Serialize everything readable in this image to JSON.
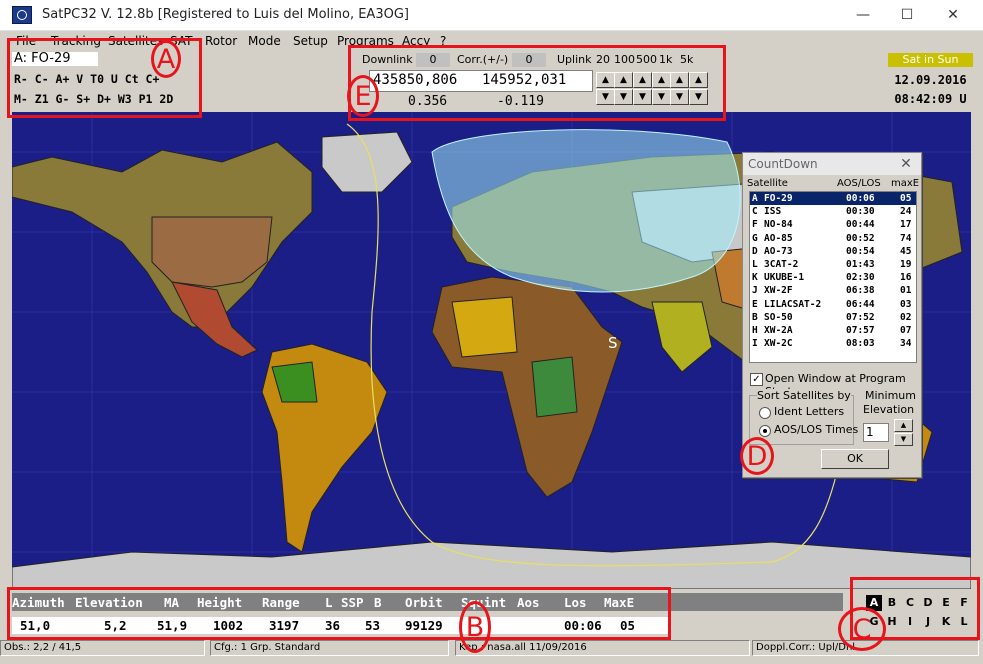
{
  "window": {
    "title": "SatPC32 V. 12.8b   [Registered to Luis del Molino, EA3OG]",
    "minimize": "—",
    "maximize": "☐",
    "close": "✕"
  },
  "menu": [
    "File",
    "Tracking",
    "Satellites",
    "SAT",
    "Rotor",
    "Mode",
    "Setup",
    "Programs",
    "Accy",
    "?"
  ],
  "satellite": {
    "current": "A: FO-29",
    "flags_row1": "R- C- A+ V T0 U Ct C+",
    "flags_row2": "M- Z1 G- S+ D+ W3 P1 2D"
  },
  "frequency": {
    "downlink_label": "Downlink",
    "downlink_value": "0",
    "corr_label": "Corr.(+/-)",
    "corr_value": "0",
    "uplink_label": "Uplink",
    "steps": [
      "20",
      "100",
      "500",
      "1k",
      "5k"
    ],
    "freq_down": "435850,806",
    "freq_up": "145952,031",
    "doppler_down": "0.356",
    "doppler_up": "-0.119"
  },
  "datetime": {
    "sun_status": "Sat in Sun",
    "date": "12.09.2016",
    "time": "08:42:09 U"
  },
  "map": {
    "sat_marker": "S",
    "colors": {
      "ocean": "#1a1e86",
      "footprint": "#a0ecfa",
      "land": "#8a7a3a",
      "track": "#e8e060"
    }
  },
  "countdown": {
    "title": "CountDown",
    "close": "✕",
    "col_satellite": "Satellite",
    "col_times": "AOS/LOS",
    "col_maxe": "maxE",
    "rows": [
      {
        "id": "A",
        "name": "FO-29",
        "time": "00:06",
        "maxe": "05"
      },
      {
        "id": "C",
        "name": "ISS",
        "time": "00:30",
        "maxe": "24"
      },
      {
        "id": "F",
        "name": "NO-84",
        "time": "00:44",
        "maxe": "17"
      },
      {
        "id": "G",
        "name": "AO-85",
        "time": "00:52",
        "maxe": "74"
      },
      {
        "id": "D",
        "name": "AO-73",
        "time": "00:54",
        "maxe": "45"
      },
      {
        "id": "L",
        "name": "3CAT-2",
        "time": "01:43",
        "maxe": "19"
      },
      {
        "id": "K",
        "name": "UKUBE-1",
        "time": "02:30",
        "maxe": "16"
      },
      {
        "id": "J",
        "name": "XW-2F",
        "time": "06:38",
        "maxe": "01"
      },
      {
        "id": "E",
        "name": "LILACSAT-2",
        "time": "06:44",
        "maxe": "03"
      },
      {
        "id": "B",
        "name": "SO-50",
        "time": "07:52",
        "maxe": "02"
      },
      {
        "id": "H",
        "name": "XW-2A",
        "time": "07:57",
        "maxe": "07"
      },
      {
        "id": "I",
        "name": "XW-2C",
        "time": "08:03",
        "maxe": "34"
      }
    ],
    "open_start_label": "Open Window at Program Start",
    "sort_label": "Sort Satellites by",
    "sort_ident": "Ident Letters",
    "sort_aos": "AOS/LOS Times",
    "min_elev_label_1": "Minimum",
    "min_elev_label_2": "Elevation",
    "min_elev_value": "1",
    "ok": "OK"
  },
  "table": {
    "headers": [
      "Azimuth",
      "Elevation",
      "MA",
      "Height",
      "Range",
      "L",
      "SSP",
      "B",
      "Orbit",
      "Squint",
      "Aos",
      "Los",
      "MaxE"
    ],
    "values": [
      "51,0",
      "5,2",
      "51,9",
      "1002",
      "3197",
      "36",
      "53",
      "99129",
      "",
      "",
      "00:06",
      "05"
    ]
  },
  "sat_grid": {
    "row1": [
      "A",
      "B",
      "C",
      "D",
      "E",
      "F"
    ],
    "row2": [
      "G",
      "H",
      "I",
      "J",
      "K",
      "L"
    ],
    "selected": "A"
  },
  "status": {
    "obs": "Obs.: 2,2 / 41,5",
    "cfg": "Cfg.: 1  Grp. Standard",
    "kep": "Kep.: nasa.all 11/09/2016",
    "doppl": "Doppl.Corr.: Upl/Dnl"
  },
  "annotations": {
    "A": "A",
    "B": "B",
    "C": "C",
    "D": "D",
    "E": "E"
  }
}
